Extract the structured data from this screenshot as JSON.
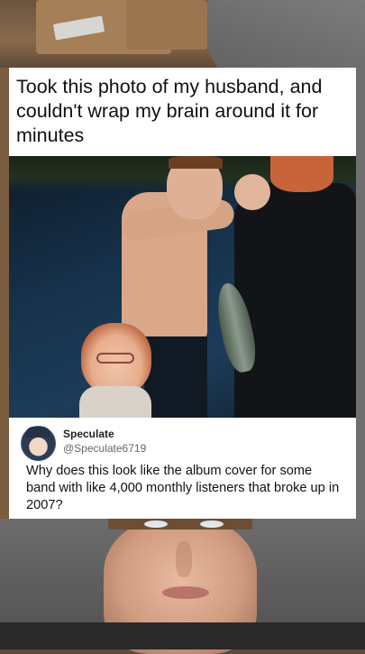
{
  "post": {
    "caption": "Took this photo of my husband, and couldn't wrap my brain around it for minutes"
  },
  "tweet": {
    "author_name": "Speculate",
    "author_handle": "@Speculate6719",
    "text": "Why does this look like the album cover for some band with like 4,000 monthly listeners that broke up in 2007?"
  },
  "colors": {
    "card_background": "#ffffff",
    "caption_text": "#111111",
    "handle_text": "#666666"
  },
  "icons": {
    "avatar": "cartoon-avatar-icon"
  }
}
